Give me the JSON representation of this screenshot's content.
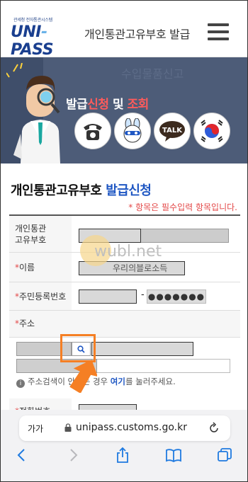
{
  "header": {
    "logo_sub": "관세청 전자통관시스템",
    "logo_main_a": "UNI",
    "logo_main_dash": "-",
    "logo_main_b": "PASS",
    "title": "개인통관고유부호  발급"
  },
  "banner": {
    "watermark": "수입물품신고",
    "text_part1": "발급",
    "text_part2": "신청",
    "text_part3": " 및 ",
    "text_part4": "조회",
    "talk_label": "TALK"
  },
  "page": {
    "title_black": "개인통관고유부호 ",
    "title_blue": "발급신청",
    "required_note": "* 항목은 필수입력 항목입니다."
  },
  "form": {
    "fields": [
      {
        "label_line1": "개인통관",
        "label_line2": "고유부호"
      },
      {
        "label": "이름",
        "required_mark": "*"
      },
      {
        "label": "주민등록번호",
        "required_mark": "*"
      },
      {
        "label": "주소",
        "required_mark": "*"
      },
      {
        "label": "전화번호",
        "required_mark": "*"
      }
    ],
    "name_overlay": "우리의블로소득",
    "rrn_dash": "-",
    "rrn_mask": "●●●●●●●",
    "watermark": "wubl.net",
    "hint_prefix": "주소검색이 안되는 경우 ",
    "hint_link": "여기",
    "hint_suffix": "를 눌러주세요."
  },
  "safari": {
    "aa": "가가",
    "url": "unipass.customs.go.kr"
  },
  "colors": {
    "brand_blue": "#1a3f8f",
    "accent_blue": "#1f57c3",
    "required_red": "#e34848",
    "highlight_orange": "#f57f24"
  }
}
